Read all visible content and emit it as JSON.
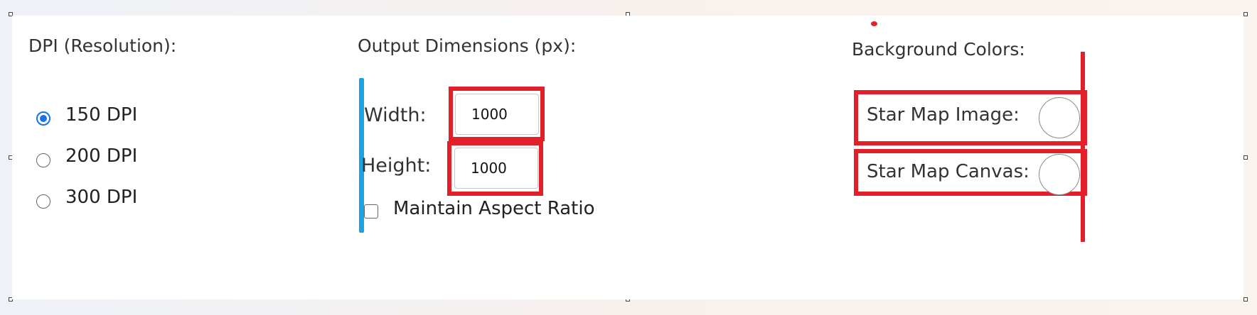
{
  "dpi": {
    "heading": "DPI (Resolution):",
    "options": [
      {
        "label": "150 DPI",
        "selected": true
      },
      {
        "label": "200 DPI",
        "selected": false
      },
      {
        "label": "300 DPI",
        "selected": false
      }
    ]
  },
  "dimensions": {
    "heading": "Output Dimensions (px):",
    "width_label": "Width:",
    "width_value": "1000",
    "height_label": "Height:",
    "height_value": "1000",
    "aspect_label": "Maintain Aspect Ratio",
    "aspect_checked": false
  },
  "background": {
    "heading": "Background Colors:",
    "image_label": "Star Map Image:",
    "canvas_label": "Star Map Canvas:"
  },
  "colors": {
    "accent_blue": "#1a73e8",
    "divider_blue": "#1aa3e0",
    "highlight_red": "#e3202a"
  }
}
